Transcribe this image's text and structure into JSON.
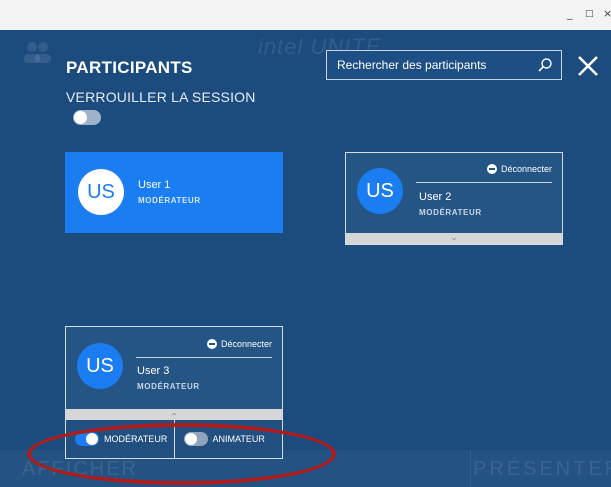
{
  "window": {
    "minimize_glyph": "_",
    "maximize_glyph": "□",
    "close_glyph": "×"
  },
  "background": {
    "logo": "intel UNITE",
    "show_label": "AFFICHER",
    "present_label": "PRÉSENTER"
  },
  "header": {
    "title": "PARTICIPANTS",
    "lock_label": "VERROUILLER LA SESSION",
    "lock_enabled": false,
    "search_placeholder": "Rechercher des participants",
    "search_icon": "search-icon",
    "close_icon": "close-icon"
  },
  "participants": [
    {
      "initials": "US",
      "name": "User 1",
      "role": "MODÉRATEUR",
      "self": true
    },
    {
      "initials": "US",
      "name": "User 2",
      "role": "MODÉRATEUR",
      "disconnect_label": "Déconnecter"
    },
    {
      "initials": "US",
      "name": "User 3",
      "role": "MODÉRATEUR",
      "disconnect_label": "Déconnecter",
      "options": [
        {
          "label": "MODÉRATEUR",
          "on": true
        },
        {
          "label": "ANIMATEUR",
          "on": false
        }
      ]
    }
  ],
  "colors": {
    "background": "#1c4b7d",
    "accent": "#1a7df1",
    "card": "#245585",
    "highlight_ring": "#b01b1b"
  }
}
